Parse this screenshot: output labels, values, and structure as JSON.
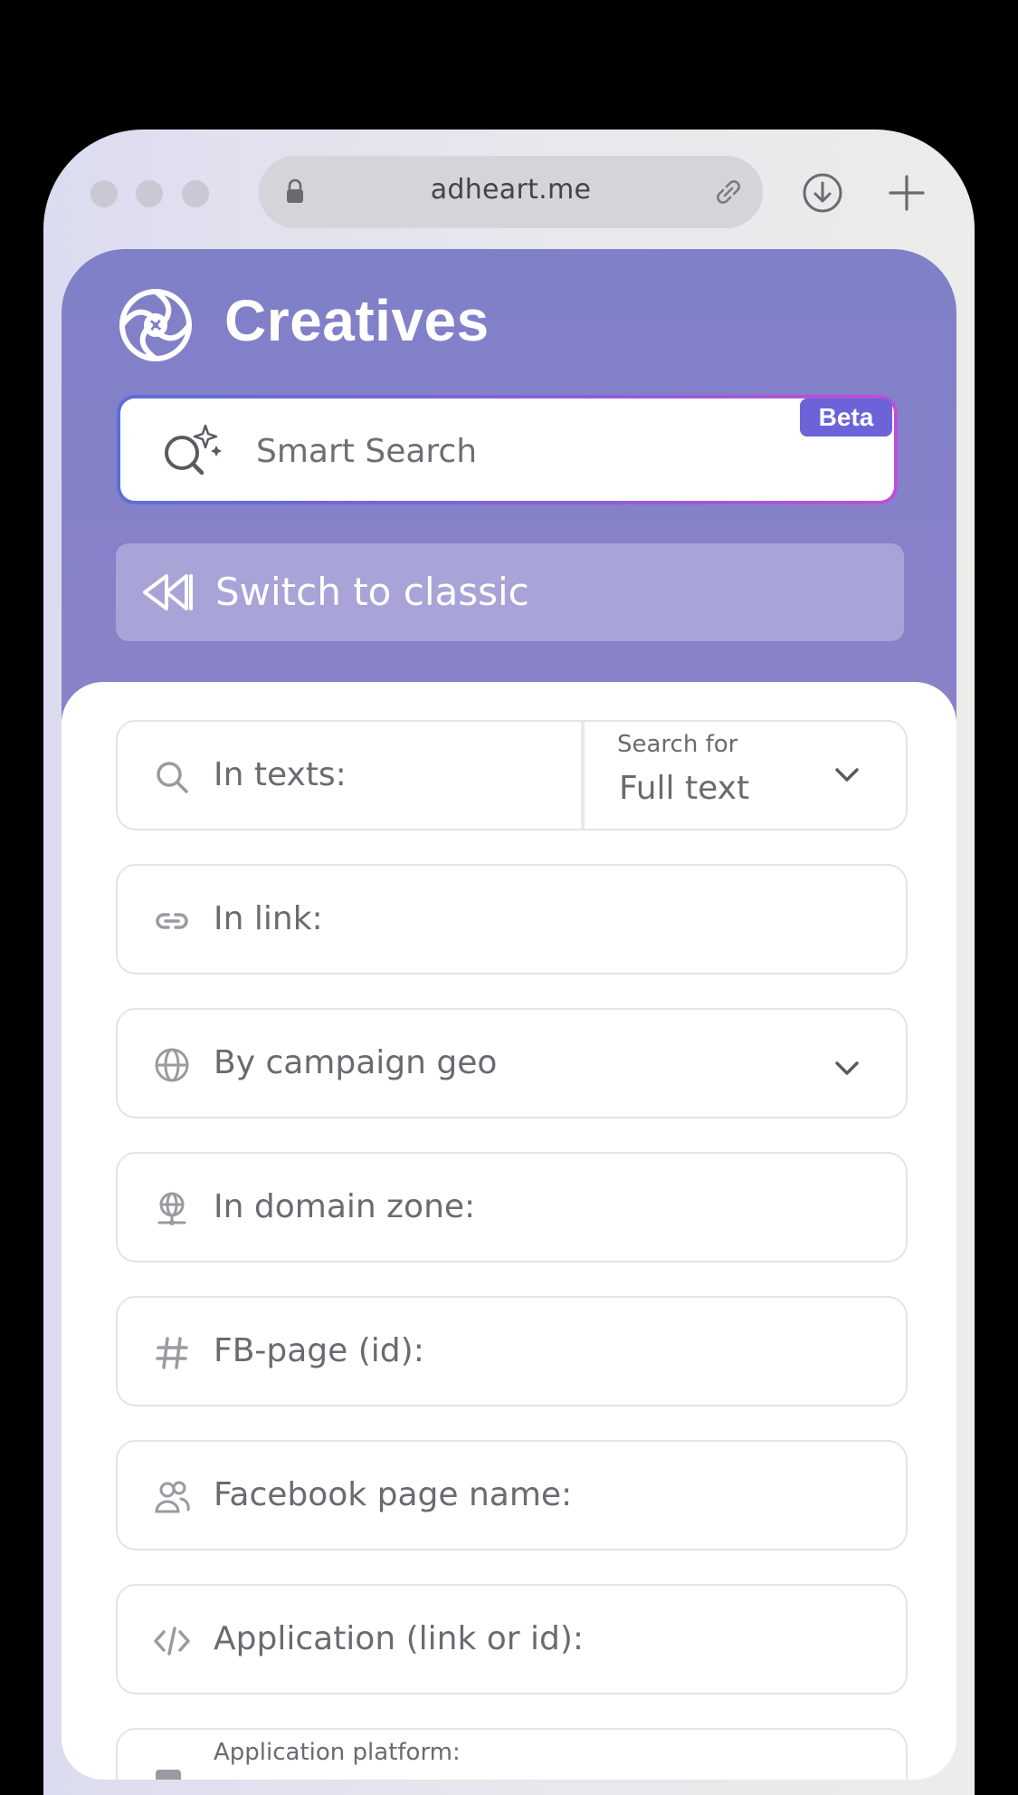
{
  "browser": {
    "url": "adheart.me"
  },
  "header": {
    "title": "Creatives"
  },
  "smart_search": {
    "placeholder": "Smart Search",
    "badge": "Beta"
  },
  "switch_classic": {
    "label": "Switch to classic"
  },
  "filters": {
    "in_texts": {
      "label": "In texts:",
      "search_for_label": "Search for",
      "search_for_value": "Full text"
    },
    "in_link": {
      "label": "In link:"
    },
    "campaign_geo": {
      "label": "By campaign geo"
    },
    "domain_zone": {
      "label": "In domain zone:"
    },
    "fb_page_id": {
      "label": "FB-page (id):"
    },
    "fb_page_name": {
      "label": "Facebook page name:"
    },
    "application": {
      "label": "Application (link or id):"
    },
    "application_platform": {
      "label": "Application platform:"
    }
  },
  "colors": {
    "hero": "#8280c8",
    "beta_badge": "#6c63d9",
    "border": "#e4e4e8",
    "label_text": "#6a6a70"
  },
  "icons": {
    "logo": "aperture-icon",
    "smart_search": "sparkle-search-icon",
    "switch": "rewind-icon",
    "in_texts": "search-icon",
    "in_link": "link-icon",
    "campaign_geo": "globe-icon",
    "domain_zone": "network-globe-icon",
    "fb_page_id": "hash-icon",
    "fb_page_name": "users-icon",
    "application": "code-icon"
  }
}
